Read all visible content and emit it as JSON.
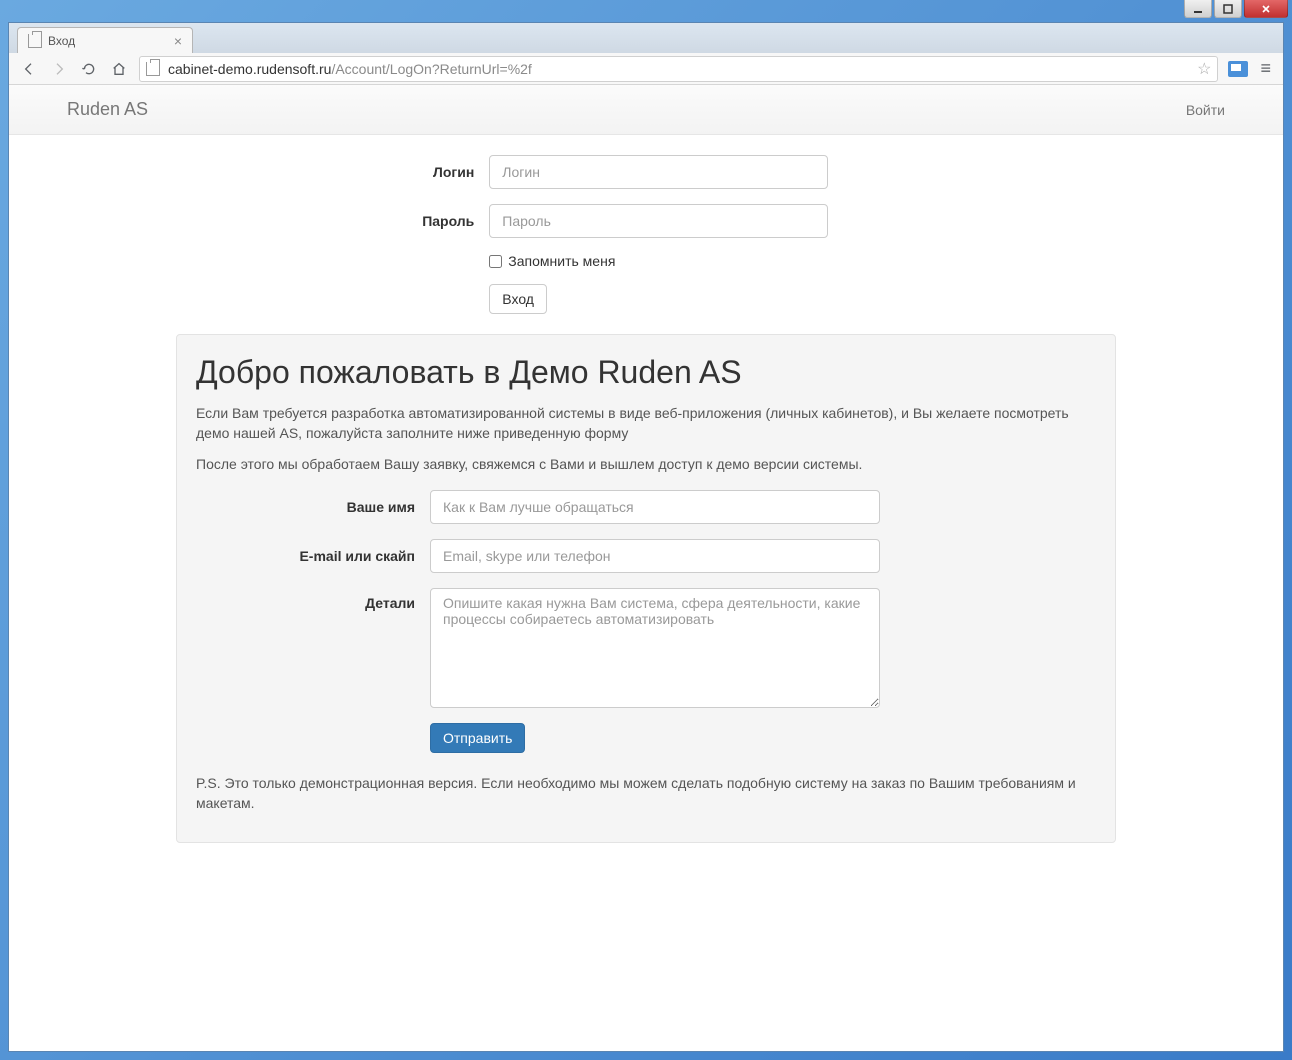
{
  "browser": {
    "tab_title": "Вход",
    "url_domain": "cabinet-demo.rudensoft.ru",
    "url_path": "/Account/LogOn?ReturnUrl=%2f"
  },
  "navbar": {
    "brand": "Ruden AS",
    "login_link": "Войти"
  },
  "login_form": {
    "login_label": "Логин",
    "login_placeholder": "Логин",
    "password_label": "Пароль",
    "password_placeholder": "Пароль",
    "remember_label": "Запомнить меня",
    "submit_label": "Вход"
  },
  "well": {
    "heading": "Добро пожаловать в Демо Ruden AS",
    "p1": "Если Вам требуется разработка автоматизированной системы в виде веб-приложения (личных кабинетов), и Вы желаете посмотреть демо нашей AS, пожалуйста заполните ниже приведенную форму",
    "p2": "После этого мы обработаем Вашу заявку, свяжемся с Вами и вышлем доступ к демо версии системы.",
    "name_label": "Ваше имя",
    "name_placeholder": "Как к Вам лучше обращаться",
    "contact_label": "E-mail или скайп",
    "contact_placeholder": "Email, skype или телефон",
    "details_label": "Детали",
    "details_placeholder": "Опишите какая нужна Вам система, сфера деятельности, какие процессы собираетесь автоматизировать",
    "submit_label": "Отправить",
    "ps": "P.S. Это только демонстрационная версия. Если необходимо мы можем сделать подобную систему на заказ по Вашим требованиям и макетам."
  }
}
